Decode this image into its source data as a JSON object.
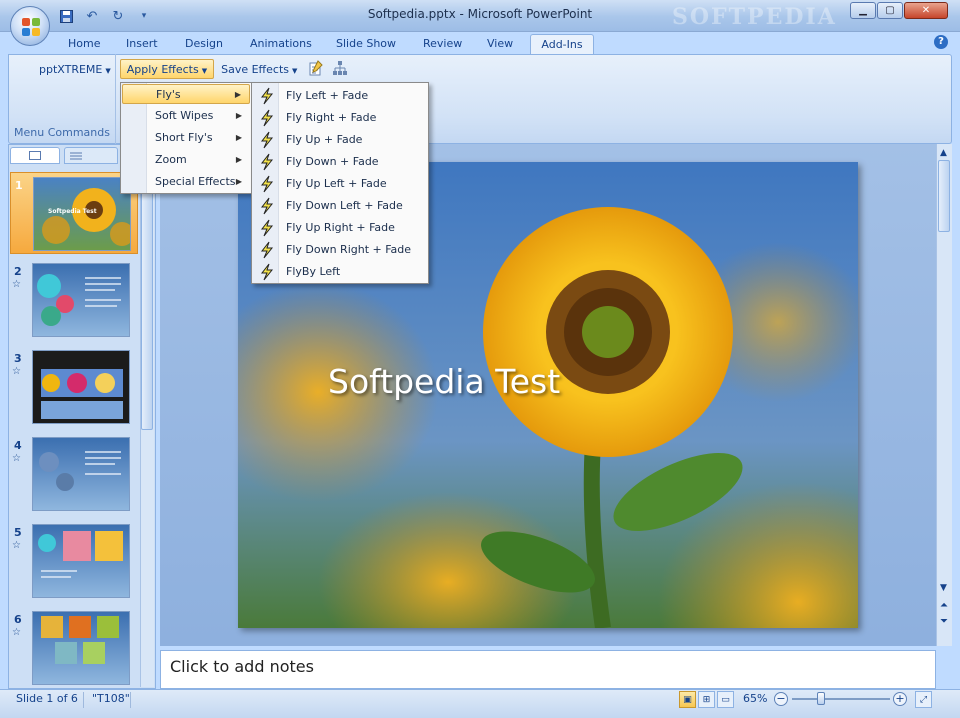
{
  "window": {
    "title": "Softpedia.pptx - Microsoft PowerPoint",
    "watermark": "SOFTPEDIA"
  },
  "qat": {
    "icons": [
      "save-icon",
      "undo-icon",
      "redo-icon",
      "customize-icon"
    ]
  },
  "tabs": [
    {
      "label": "Home",
      "active": false
    },
    {
      "label": "Insert",
      "active": false
    },
    {
      "label": "Design",
      "active": false
    },
    {
      "label": "Animations",
      "active": false
    },
    {
      "label": "Slide Show",
      "active": false
    },
    {
      "label": "Review",
      "active": false
    },
    {
      "label": "View",
      "active": false
    },
    {
      "label": "Add-Ins",
      "active": true
    }
  ],
  "help_label": "?",
  "ribbon": {
    "pptxtreme": "pptXTREME",
    "apply_effects": "Apply Effects",
    "save_effects": "Save Effects",
    "group_label": "Menu Commands",
    "icons": [
      "edit-note-icon",
      "org-chart-icon"
    ]
  },
  "menu_apply": [
    {
      "label": "Fly's",
      "highlighted": true
    },
    {
      "label": "Soft Wipes",
      "highlighted": false
    },
    {
      "label": "Short Fly's",
      "highlighted": false
    },
    {
      "label": "Zoom",
      "highlighted": false
    },
    {
      "label": "Special Effects",
      "highlighted": false
    }
  ],
  "menu_flys": [
    {
      "label": "Fly Left + Fade",
      "icon": "lightning-icon"
    },
    {
      "label": "Fly Right + Fade",
      "icon": "lightning-icon"
    },
    {
      "label": "Fly Up + Fade",
      "icon": "lightning-icon"
    },
    {
      "label": "Fly Down + Fade",
      "icon": "lightning-icon"
    },
    {
      "label": "Fly Up Left + Fade",
      "icon": "lightning-icon"
    },
    {
      "label": "Fly Down Left + Fade",
      "icon": "lightning-icon"
    },
    {
      "label": "Fly Up Right + Fade",
      "icon": "lightning-icon"
    },
    {
      "label": "Fly Down Right + Fade",
      "icon": "lightning-icon"
    },
    {
      "label": "FlyBy Left",
      "icon": "lightning-icon"
    }
  ],
  "slides": [
    {
      "num": "1",
      "selected": true,
      "animated": false,
      "thumb_title": "Softpedia Test"
    },
    {
      "num": "2",
      "selected": false,
      "animated": true
    },
    {
      "num": "3",
      "selected": false,
      "animated": true
    },
    {
      "num": "4",
      "selected": false,
      "animated": true
    },
    {
      "num": "5",
      "selected": false,
      "animated": true
    },
    {
      "num": "6",
      "selected": false,
      "animated": true
    }
  ],
  "main_slide": {
    "title": "Softpedia Test"
  },
  "notes_placeholder": "Click to add notes",
  "status": {
    "slide": "Slide 1 of 6",
    "theme": "\"T108\"",
    "zoom": "65%"
  },
  "colors": {
    "accent": "#15428b",
    "highlight": "#ffd56b",
    "ribbon": "#d2e2f6"
  }
}
